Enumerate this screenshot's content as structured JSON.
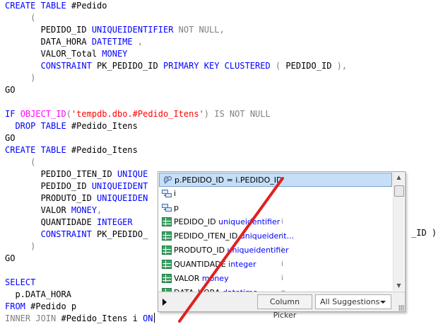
{
  "editor": {
    "lines": [
      {
        "parts": [
          {
            "t": "CREATE TABLE",
            "c": "kw"
          },
          {
            "t": " #Pedido",
            "c": ""
          }
        ]
      },
      {
        "parts": [
          {
            "t": "     (",
            "c": "gray"
          }
        ]
      },
      {
        "parts": [
          {
            "t": "       PEDIDO_ID ",
            "c": ""
          },
          {
            "t": "UNIQUEIDENTIFIER",
            "c": "kw"
          },
          {
            "t": " NOT NULL",
            "c": "gray"
          },
          {
            "t": ",",
            "c": "gray"
          }
        ]
      },
      {
        "parts": [
          {
            "t": "       DATA_HORA ",
            "c": ""
          },
          {
            "t": "DATETIME",
            "c": "kw"
          },
          {
            "t": " ,",
            "c": "gray"
          }
        ]
      },
      {
        "parts": [
          {
            "t": "       VALOR_Total ",
            "c": ""
          },
          {
            "t": "MONEY",
            "c": "kw"
          }
        ]
      },
      {
        "parts": [
          {
            "t": "       CONSTRAINT",
            "c": "kw"
          },
          {
            "t": " PK_PEDIDO_ID ",
            "c": ""
          },
          {
            "t": "PRIMARY KEY CLUSTERED",
            "c": "kw"
          },
          {
            "t": " ( ",
            "c": "gray"
          },
          {
            "t": "PEDIDO_ID",
            "c": ""
          },
          {
            "t": " ),",
            "c": "gray"
          }
        ]
      },
      {
        "parts": [
          {
            "t": "     )",
            "c": "gray"
          }
        ]
      },
      {
        "parts": [
          {
            "t": "GO",
            "c": ""
          }
        ]
      },
      {
        "parts": [
          {
            "t": "",
            "c": ""
          }
        ]
      },
      {
        "parts": [
          {
            "t": "IF",
            "c": "kw"
          },
          {
            "t": " ",
            "c": ""
          },
          {
            "t": "OBJECT_ID",
            "c": "fn"
          },
          {
            "t": "(",
            "c": "gray"
          },
          {
            "t": "'tempdb.dbo.#Pedido_Itens'",
            "c": "str"
          },
          {
            "t": ")",
            "c": "gray"
          },
          {
            "t": " IS NOT NULL",
            "c": "gray"
          }
        ]
      },
      {
        "parts": [
          {
            "t": "  DROP TABLE",
            "c": "kw"
          },
          {
            "t": " #Pedido_Itens",
            "c": ""
          }
        ]
      },
      {
        "parts": [
          {
            "t": "GO",
            "c": ""
          }
        ]
      },
      {
        "parts": [
          {
            "t": "CREATE TABLE",
            "c": "kw"
          },
          {
            "t": " #Pedido_Itens",
            "c": ""
          }
        ]
      },
      {
        "parts": [
          {
            "t": "     (",
            "c": "gray"
          }
        ]
      },
      {
        "parts": [
          {
            "t": "       PEDIDO_ITEN_ID ",
            "c": ""
          },
          {
            "t": "UNIQUE",
            "c": "kw"
          }
        ]
      },
      {
        "parts": [
          {
            "t": "       PEDIDO_ID ",
            "c": ""
          },
          {
            "t": "UNIQUEIDENT",
            "c": "kw"
          }
        ]
      },
      {
        "parts": [
          {
            "t": "       PRODUTO_ID ",
            "c": ""
          },
          {
            "t": "UNIQUEIDEN",
            "c": "kw"
          }
        ]
      },
      {
        "parts": [
          {
            "t": "       VALOR ",
            "c": ""
          },
          {
            "t": "MONEY",
            "c": "kw"
          },
          {
            "t": ",",
            "c": "gray"
          }
        ]
      },
      {
        "parts": [
          {
            "t": "       QUANTIDADE ",
            "c": ""
          },
          {
            "t": "INTEGER",
            "c": "kw"
          }
        ]
      },
      {
        "parts": [
          {
            "t": "       CONSTRAINT",
            "c": "kw"
          },
          {
            "t": " PK_PEDIDO_",
            "c": ""
          }
        ]
      },
      {
        "parts": [
          {
            "t": "     )",
            "c": "gray"
          }
        ]
      },
      {
        "parts": [
          {
            "t": "GO",
            "c": ""
          }
        ]
      },
      {
        "parts": [
          {
            "t": "",
            "c": ""
          }
        ]
      },
      {
        "parts": [
          {
            "t": "SELECT",
            "c": "kw"
          }
        ]
      },
      {
        "parts": [
          {
            "t": "  p.DATA_HORA",
            "c": ""
          }
        ]
      },
      {
        "parts": [
          {
            "t": "FROM",
            "c": "kw"
          },
          {
            "t": " #Pedido p",
            "c": ""
          }
        ]
      },
      {
        "parts": [
          {
            "t": "INNER JOIN",
            "c": "gray"
          },
          {
            "t": " #Pedido_Itens i ",
            "c": ""
          },
          {
            "t": "ON",
            "c": "kw"
          }
        ]
      }
    ],
    "hidden_tail": "_ID )"
  },
  "intellisense": {
    "items": [
      {
        "icon": "join-icon",
        "name": "p.PEDIDO_ID = i.PEDIDO_ID",
        "type": "",
        "tag": "",
        "selected": true
      },
      {
        "icon": "alias-icon",
        "name": "i",
        "type": "",
        "tag": ""
      },
      {
        "icon": "alias-icon",
        "name": "p",
        "type": "",
        "tag": ""
      },
      {
        "icon": "column-icon",
        "name": "PEDIDO_ID ",
        "type": "uniqueidentifier",
        "tag": "i"
      },
      {
        "icon": "column-icon",
        "name": "PEDIDO_ITEN_ID ",
        "type": "uniqueident...",
        "tag": "i"
      },
      {
        "icon": "column-icon",
        "name": "PRODUTO_ID ",
        "type": "uniqueidentifier",
        "tag": "i"
      },
      {
        "icon": "column-icon",
        "name": "QUANTIDADE ",
        "type": "integer",
        "tag": "i"
      },
      {
        "icon": "column-icon",
        "name": "VALOR ",
        "type": "money",
        "tag": "i"
      },
      {
        "icon": "column-icon",
        "name": "DATA_HORA ",
        "type": "datetime",
        "tag": "p"
      }
    ],
    "footer": {
      "column_picker": "Column Picker",
      "all_suggestions": "All Suggestions"
    }
  },
  "colors": {
    "keyword": "#0000ff",
    "operator": "#808080",
    "function": "#ff00ff",
    "string": "#ff0000",
    "selection": "#c5dff8",
    "strike": "#e02020"
  }
}
